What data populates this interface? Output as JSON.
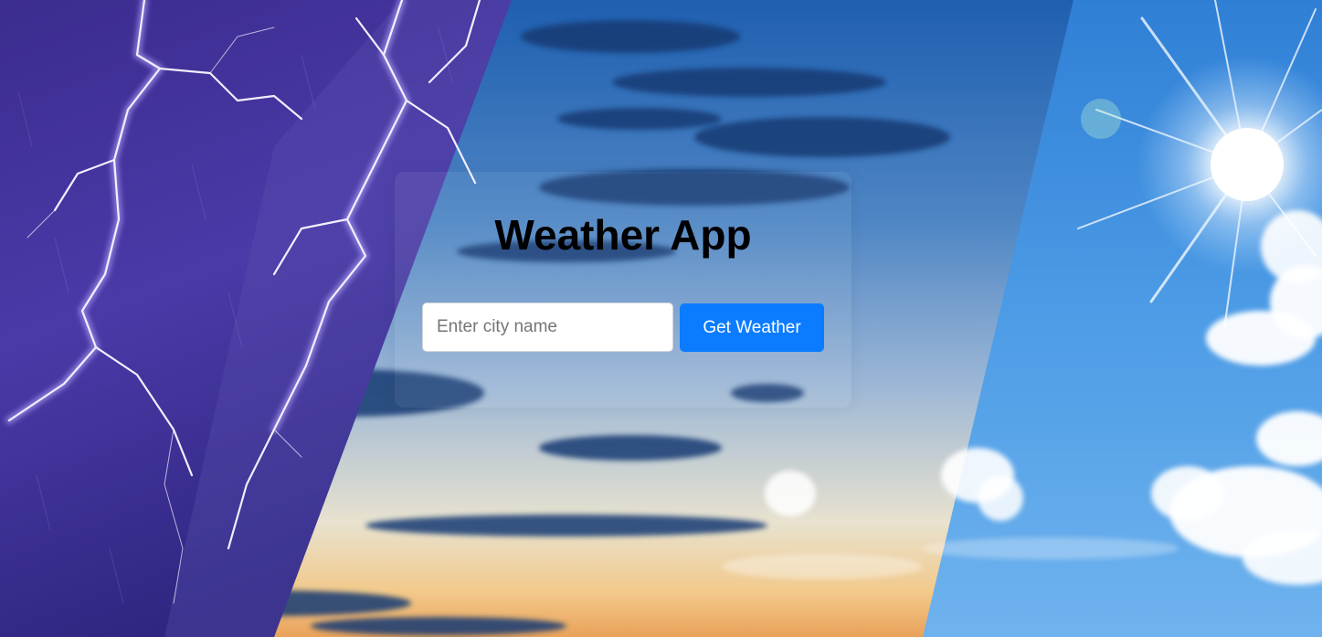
{
  "app": {
    "title": "Weather App"
  },
  "search": {
    "value": "",
    "placeholder": "Enter city name"
  },
  "actions": {
    "get_weather_label": "Get Weather"
  },
  "colors": {
    "button": "#0b7cff",
    "title": "#000000",
    "storm": "#3c2f96",
    "cloudy_sky": "#3b70b4",
    "sunny_sky": "#3f97e4"
  },
  "background": {
    "panels": [
      "storm-lightning",
      "sunset-clouds",
      "sunny-sky"
    ],
    "icons": [
      "lightning-icon",
      "sun-icon",
      "cloud-icon"
    ]
  }
}
